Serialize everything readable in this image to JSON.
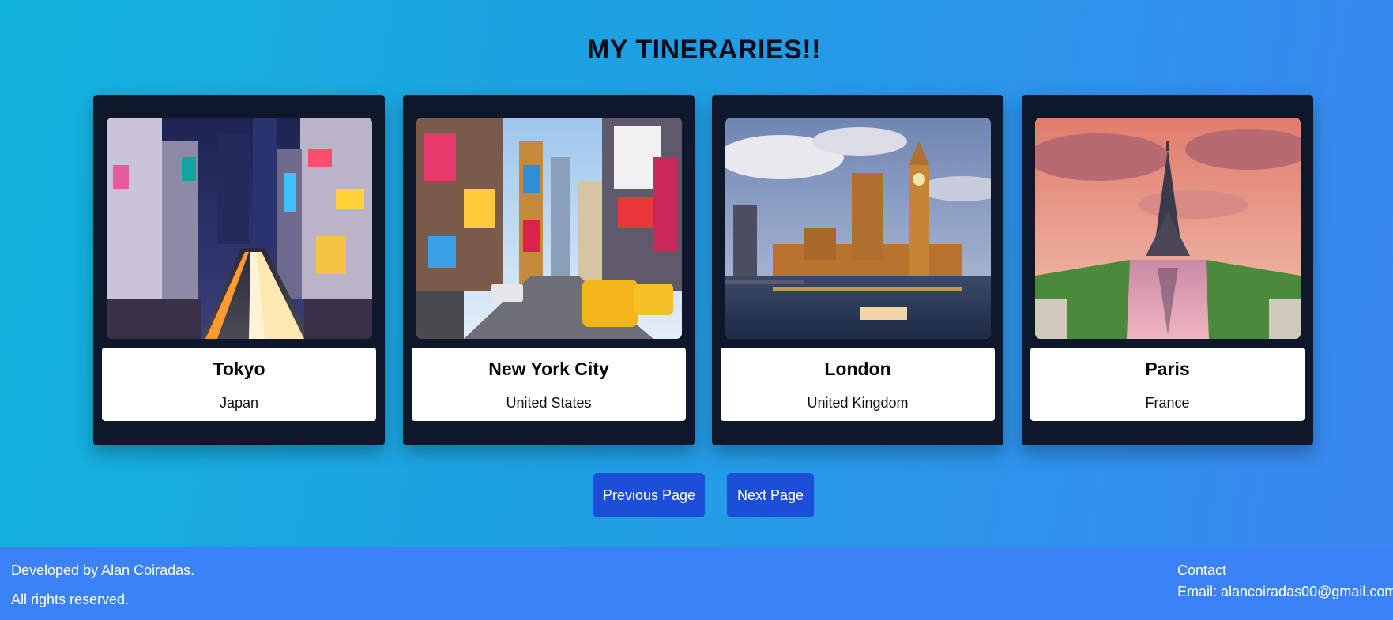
{
  "page": {
    "title": "MY TINERARIES!!"
  },
  "cards": [
    {
      "city": "Tokyo",
      "country": "Japan",
      "image": "tokyo-night-street-photo"
    },
    {
      "city": "New York City",
      "country": "United States",
      "image": "times-square-photo"
    },
    {
      "city": "London",
      "country": "United Kingdom",
      "image": "big-ben-parliament-photo"
    },
    {
      "city": "Paris",
      "country": "France",
      "image": "eiffel-tower-photo"
    }
  ],
  "pagination": {
    "previous_label": "Previous Page",
    "next_label": "Next Page"
  },
  "footer": {
    "developer": "Developed by Alan Coiradas.",
    "rights": "All rights reserved.",
    "contact_title": "Contact",
    "contact_email": "Email: alancoiradas00@gmail.com"
  },
  "colors": {
    "card_bg": "#0f172a",
    "button_bg": "#1d4ed8",
    "footer_bg": "#3b82f6",
    "background_start": "#12b3dc",
    "background_end": "#3a86f0"
  }
}
